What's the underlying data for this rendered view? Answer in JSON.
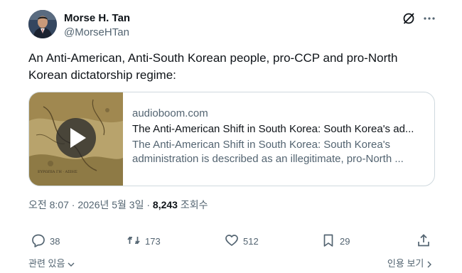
{
  "author": {
    "name": "Morse H. Tan",
    "handle": "@MorseHTan"
  },
  "tweet": {
    "text": "An Anti-American, Anti-South Korean people, pro-CCP and pro-North Korean dictatorship regime:"
  },
  "card": {
    "domain": "audioboom.com",
    "title": "The Anti-American Shift in South Korea: South Korea's ad...",
    "description": "The Anti-American Shift in South Korea: South Korea's administration is described as an illegitimate, pro-North ..."
  },
  "meta": {
    "time_date": "오전 8:07 · 2026년 5월 3일 · ",
    "views_count": "8,243",
    "views_label": " 조회수"
  },
  "actions": {
    "replies": "38",
    "reposts": "173",
    "likes": "512",
    "bookmarks": "29"
  },
  "footer": {
    "related": "관련 있음",
    "quotes": "인용 보기"
  },
  "icons": {
    "grok": "grok-icon",
    "more": "more-icon",
    "reply": "reply-icon",
    "repost": "repost-icon",
    "like": "heart-icon",
    "bookmark": "bookmark-icon",
    "share": "share-icon"
  }
}
